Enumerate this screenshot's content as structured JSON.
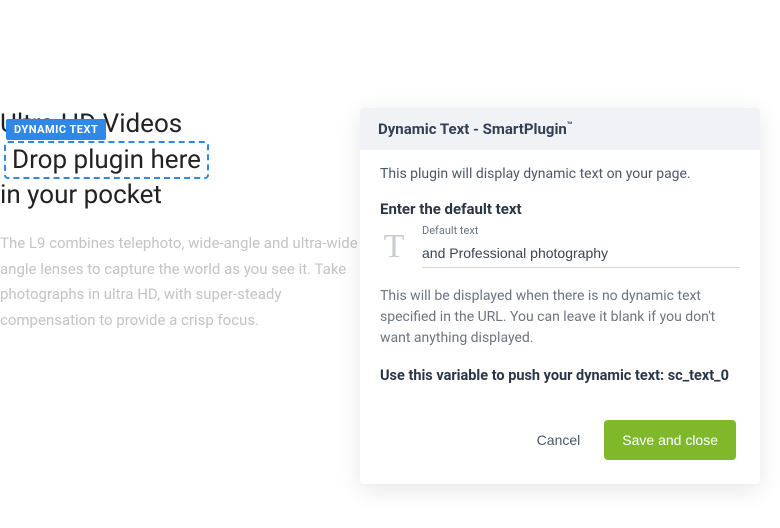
{
  "page": {
    "headline_pre": "Ultra HD Videos",
    "plugin_badge": "DYNAMIC TEXT",
    "plugin_placeholder_text": "Drop plugin here",
    "headline_post": "in your pocket",
    "body": "The L9 combines telephoto, wide-angle and ultra-wide angle lenses to capture the world as you see it. Take photographs in ultra HD, with super-steady compensation to provide a crisp focus."
  },
  "panel": {
    "title_main": "Dynamic Text - SmartPlugin",
    "title_tm": "™",
    "description": "This plugin will display dynamic text on your page.",
    "section_label": "Enter the default text",
    "t_glyph": "T",
    "input_label": "Default text",
    "input_value": "and Professional photography",
    "help": "This will be displayed when there is no dynamic text specified in the URL. You can leave it blank if you don't want anything displayed.",
    "variable_prefix": "Use this variable to push your dynamic text: ",
    "variable_name": "sc_text_0",
    "cancel_label": "Cancel",
    "save_label": "Save and close"
  }
}
